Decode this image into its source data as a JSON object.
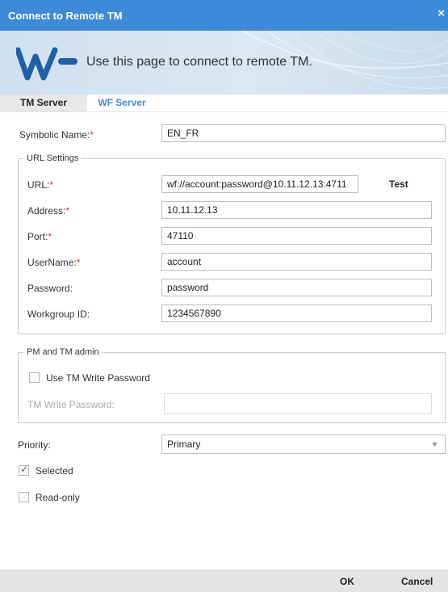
{
  "window": {
    "title": "Connect to Remote TM",
    "close_glyph": "×"
  },
  "banner": {
    "logo_icon": "wf-logo",
    "headline": "Use this page to connect to remote TM."
  },
  "tabs": [
    {
      "label": "TM Server"
    },
    {
      "label": "WF Server"
    }
  ],
  "form": {
    "symbolic_name": {
      "label": "Symbolic Name:",
      "required": "*",
      "value": "EN_FR"
    },
    "url_settings": {
      "legend": "URL Settings",
      "url": {
        "label": "URL:",
        "required": "*",
        "value": "wf://account:password@10.11.12.13:4711"
      },
      "test_label": "Test",
      "address": {
        "label": "Address:",
        "required": "*",
        "value": "10.11.12.13"
      },
      "port": {
        "label": "Port:",
        "required": "*",
        "value": "47110"
      },
      "username": {
        "label": "UserName:",
        "required": "*",
        "value": "account"
      },
      "password": {
        "label": "Password:",
        "value": "password"
      },
      "workgroup": {
        "label": "Workgroup ID:",
        "value": "1234567890"
      }
    },
    "pm_tm_admin": {
      "legend": "PM and TM admin",
      "use_write_password": {
        "label": "Use TM Write Password",
        "checked": false
      },
      "write_password": {
        "label": "TM Write Password:",
        "value": ""
      }
    },
    "priority": {
      "label": "Priority:",
      "value": "Primary"
    },
    "selected": {
      "label": "Selected",
      "checked": true,
      "mark": "✓"
    },
    "read_only": {
      "label": "Read-only",
      "checked": false
    }
  },
  "footer": {
    "ok_label": "OK",
    "cancel_label": "Cancel"
  },
  "colors": {
    "accent": "#3f8ad8",
    "required": "#e03131"
  }
}
